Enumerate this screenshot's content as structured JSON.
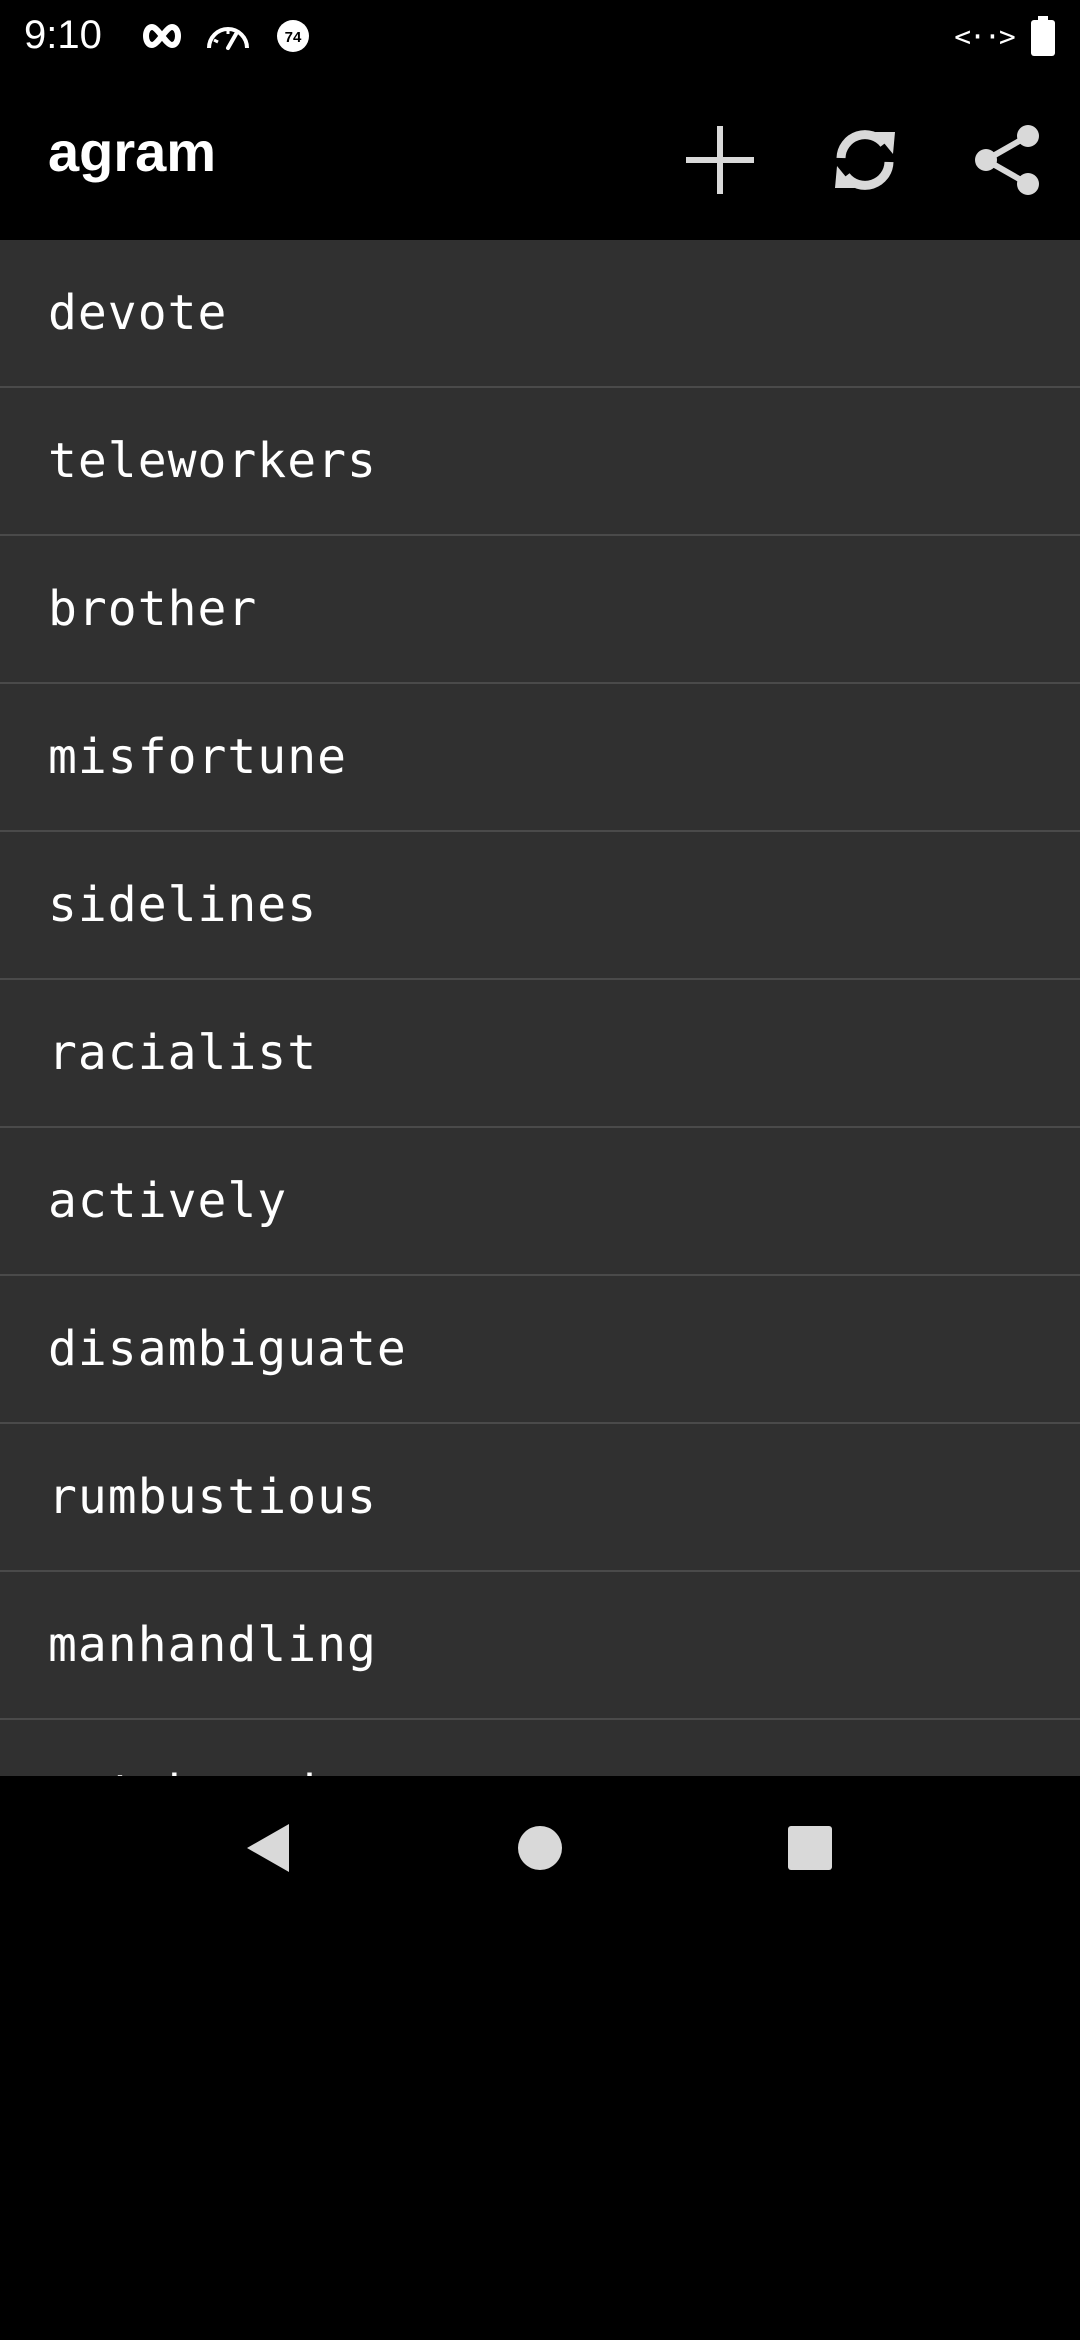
{
  "status_bar": {
    "time": "9:10",
    "icons": [
      "infinity-icon",
      "speedometer-icon",
      "badge-74-icon",
      "code-arrows-icon",
      "battery-icon"
    ],
    "badge_number": "74",
    "code_glyph": "<··>"
  },
  "app_bar": {
    "title": "agram",
    "actions": [
      "add-icon",
      "refresh-icon",
      "share-icon"
    ]
  },
  "words": [
    "devote",
    "teleworkers",
    "brother",
    "misfortune",
    "sidelines",
    "racialist",
    "actively",
    "disambiguate",
    "rumbustious",
    "manhandling",
    "catchwords"
  ],
  "nav_bar": {
    "buttons": [
      "back-icon",
      "home-icon",
      "recents-icon"
    ]
  },
  "colors": {
    "background": "#000000",
    "list_background": "#303030",
    "divider": "#4a4a4a",
    "text": "#ffffff",
    "icon": "#d9d9d9"
  }
}
